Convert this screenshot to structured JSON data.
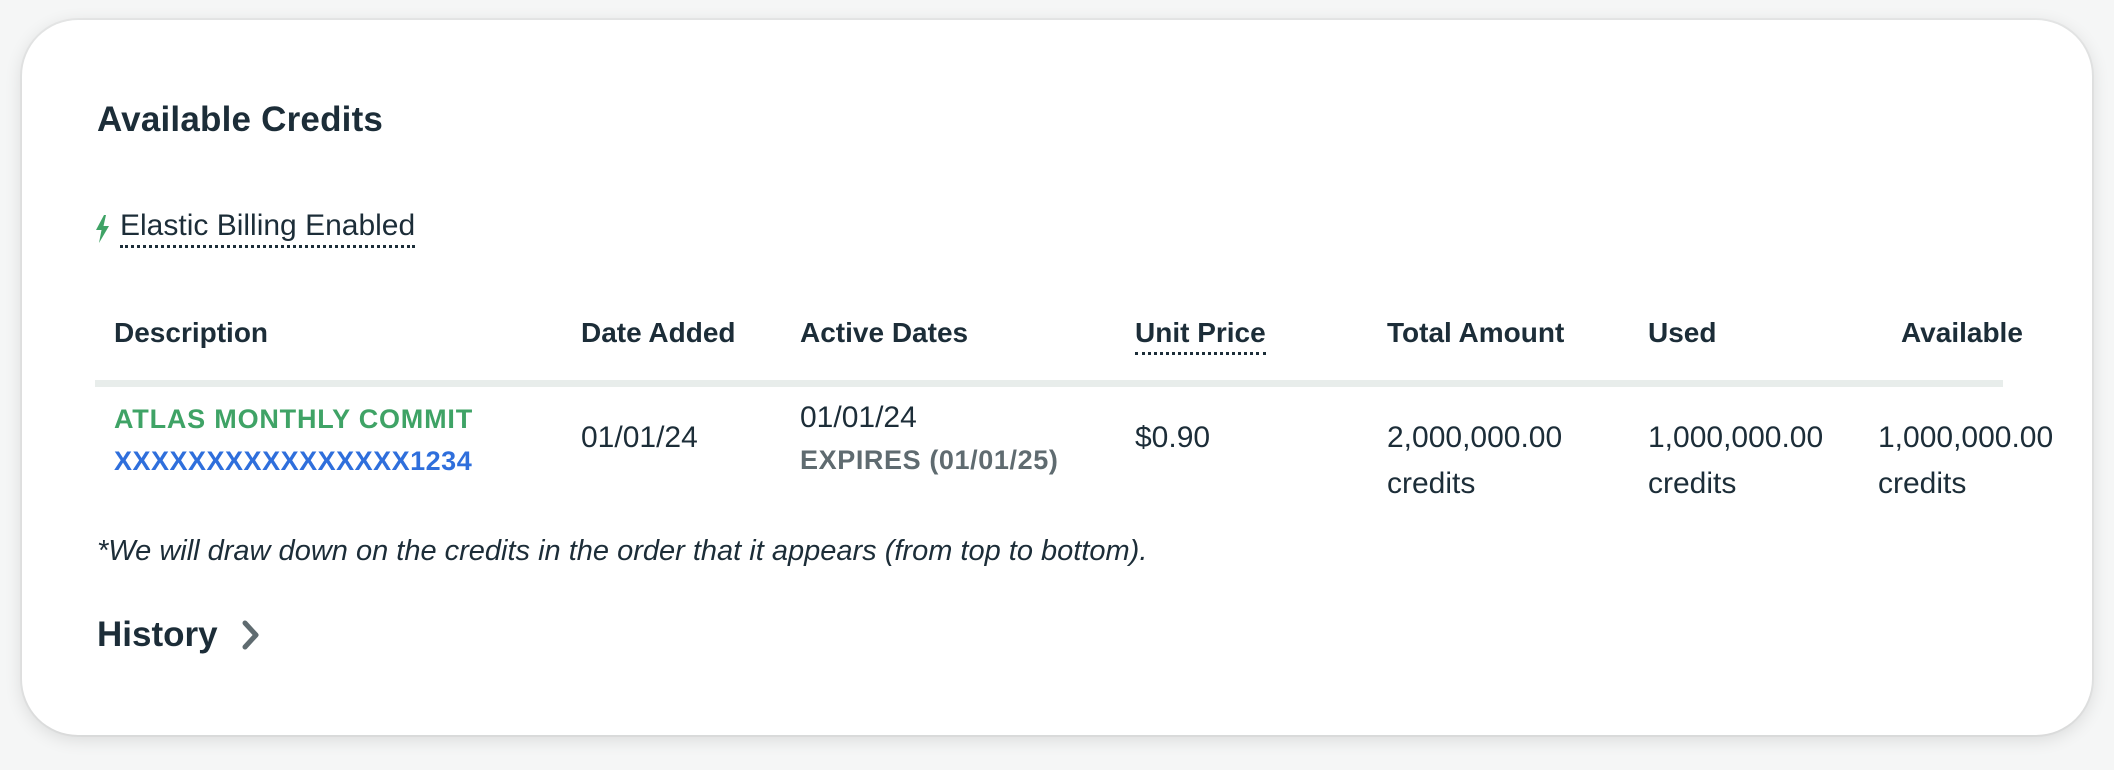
{
  "panel": {
    "title": "Available Credits",
    "elastic_billing_label": "Elastic Billing Enabled"
  },
  "table": {
    "columns": [
      "Description",
      "Date Added",
      "Active Dates",
      "Unit Price",
      "Total Amount",
      "Used",
      "Available"
    ],
    "rows": [
      {
        "description_name": "ATLAS MONTHLY COMMIT",
        "description_id": "XXXXXXXXXXXXXXXX1234",
        "date_added": "01/01/24",
        "active_start": "01/01/24",
        "active_expires": "EXPIRES (01/01/25)",
        "unit_price": "$0.90",
        "total_amount": "2,000,000.00",
        "total_unit": "credits",
        "used": "1,000,000.00",
        "used_unit": "credits",
        "available": "1,000,000.00",
        "available_unit": "credits"
      }
    ]
  },
  "footnote": "*We will draw down on the credits in the order that it appears (from top to bottom).",
  "history": {
    "label": "History"
  },
  "colors": {
    "accent_green": "#3fa366",
    "link_blue": "#2f6fdc",
    "text_dark": "#1c2d38",
    "muted": "#5f6b70"
  },
  "icons": {
    "elastic": "lightning-bolt-icon",
    "history": "chevron-right-icon"
  }
}
